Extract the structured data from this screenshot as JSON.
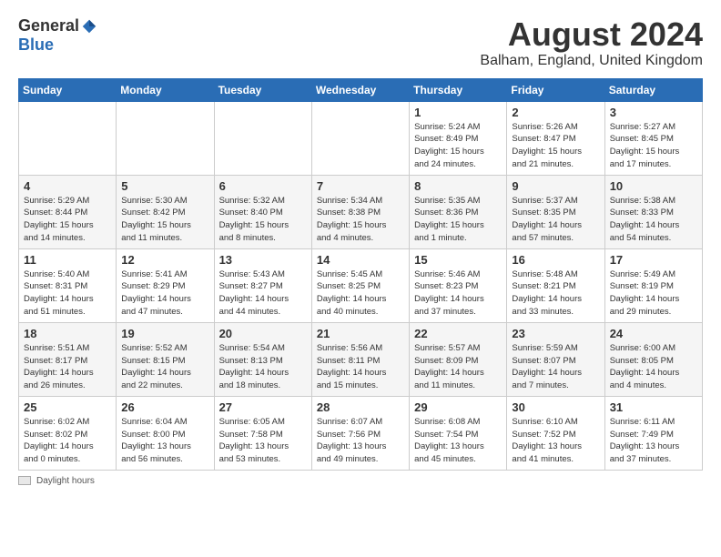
{
  "header": {
    "logo_general": "General",
    "logo_blue": "Blue",
    "month_year": "August 2024",
    "location": "Balham, England, United Kingdom"
  },
  "days_of_week": [
    "Sunday",
    "Monday",
    "Tuesday",
    "Wednesday",
    "Thursday",
    "Friday",
    "Saturday"
  ],
  "weeks": [
    [
      {
        "day": "",
        "info": ""
      },
      {
        "day": "",
        "info": ""
      },
      {
        "day": "",
        "info": ""
      },
      {
        "day": "",
        "info": ""
      },
      {
        "day": "1",
        "info": "Sunrise: 5:24 AM\nSunset: 8:49 PM\nDaylight: 15 hours\nand 24 minutes."
      },
      {
        "day": "2",
        "info": "Sunrise: 5:26 AM\nSunset: 8:47 PM\nDaylight: 15 hours\nand 21 minutes."
      },
      {
        "day": "3",
        "info": "Sunrise: 5:27 AM\nSunset: 8:45 PM\nDaylight: 15 hours\nand 17 minutes."
      }
    ],
    [
      {
        "day": "4",
        "info": "Sunrise: 5:29 AM\nSunset: 8:44 PM\nDaylight: 15 hours\nand 14 minutes."
      },
      {
        "day": "5",
        "info": "Sunrise: 5:30 AM\nSunset: 8:42 PM\nDaylight: 15 hours\nand 11 minutes."
      },
      {
        "day": "6",
        "info": "Sunrise: 5:32 AM\nSunset: 8:40 PM\nDaylight: 15 hours\nand 8 minutes."
      },
      {
        "day": "7",
        "info": "Sunrise: 5:34 AM\nSunset: 8:38 PM\nDaylight: 15 hours\nand 4 minutes."
      },
      {
        "day": "8",
        "info": "Sunrise: 5:35 AM\nSunset: 8:36 PM\nDaylight: 15 hours\nand 1 minute."
      },
      {
        "day": "9",
        "info": "Sunrise: 5:37 AM\nSunset: 8:35 PM\nDaylight: 14 hours\nand 57 minutes."
      },
      {
        "day": "10",
        "info": "Sunrise: 5:38 AM\nSunset: 8:33 PM\nDaylight: 14 hours\nand 54 minutes."
      }
    ],
    [
      {
        "day": "11",
        "info": "Sunrise: 5:40 AM\nSunset: 8:31 PM\nDaylight: 14 hours\nand 51 minutes."
      },
      {
        "day": "12",
        "info": "Sunrise: 5:41 AM\nSunset: 8:29 PM\nDaylight: 14 hours\nand 47 minutes."
      },
      {
        "day": "13",
        "info": "Sunrise: 5:43 AM\nSunset: 8:27 PM\nDaylight: 14 hours\nand 44 minutes."
      },
      {
        "day": "14",
        "info": "Sunrise: 5:45 AM\nSunset: 8:25 PM\nDaylight: 14 hours\nand 40 minutes."
      },
      {
        "day": "15",
        "info": "Sunrise: 5:46 AM\nSunset: 8:23 PM\nDaylight: 14 hours\nand 37 minutes."
      },
      {
        "day": "16",
        "info": "Sunrise: 5:48 AM\nSunset: 8:21 PM\nDaylight: 14 hours\nand 33 minutes."
      },
      {
        "day": "17",
        "info": "Sunrise: 5:49 AM\nSunset: 8:19 PM\nDaylight: 14 hours\nand 29 minutes."
      }
    ],
    [
      {
        "day": "18",
        "info": "Sunrise: 5:51 AM\nSunset: 8:17 PM\nDaylight: 14 hours\nand 26 minutes."
      },
      {
        "day": "19",
        "info": "Sunrise: 5:52 AM\nSunset: 8:15 PM\nDaylight: 14 hours\nand 22 minutes."
      },
      {
        "day": "20",
        "info": "Sunrise: 5:54 AM\nSunset: 8:13 PM\nDaylight: 14 hours\nand 18 minutes."
      },
      {
        "day": "21",
        "info": "Sunrise: 5:56 AM\nSunset: 8:11 PM\nDaylight: 14 hours\nand 15 minutes."
      },
      {
        "day": "22",
        "info": "Sunrise: 5:57 AM\nSunset: 8:09 PM\nDaylight: 14 hours\nand 11 minutes."
      },
      {
        "day": "23",
        "info": "Sunrise: 5:59 AM\nSunset: 8:07 PM\nDaylight: 14 hours\nand 7 minutes."
      },
      {
        "day": "24",
        "info": "Sunrise: 6:00 AM\nSunset: 8:05 PM\nDaylight: 14 hours\nand 4 minutes."
      }
    ],
    [
      {
        "day": "25",
        "info": "Sunrise: 6:02 AM\nSunset: 8:02 PM\nDaylight: 14 hours\nand 0 minutes."
      },
      {
        "day": "26",
        "info": "Sunrise: 6:04 AM\nSunset: 8:00 PM\nDaylight: 13 hours\nand 56 minutes."
      },
      {
        "day": "27",
        "info": "Sunrise: 6:05 AM\nSunset: 7:58 PM\nDaylight: 13 hours\nand 53 minutes."
      },
      {
        "day": "28",
        "info": "Sunrise: 6:07 AM\nSunset: 7:56 PM\nDaylight: 13 hours\nand 49 minutes."
      },
      {
        "day": "29",
        "info": "Sunrise: 6:08 AM\nSunset: 7:54 PM\nDaylight: 13 hours\nand 45 minutes."
      },
      {
        "day": "30",
        "info": "Sunrise: 6:10 AM\nSunset: 7:52 PM\nDaylight: 13 hours\nand 41 minutes."
      },
      {
        "day": "31",
        "info": "Sunrise: 6:11 AM\nSunset: 7:49 PM\nDaylight: 13 hours\nand 37 minutes."
      }
    ]
  ],
  "footer": {
    "daylight_hours_label": "Daylight hours"
  }
}
